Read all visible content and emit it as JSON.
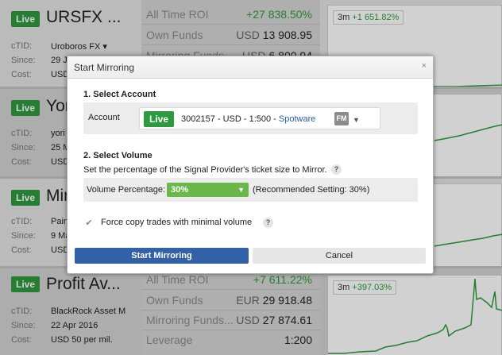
{
  "cards": [
    {
      "live": "Live",
      "title": "URSFX ...",
      "info": [
        {
          "label": "cTID:",
          "value": "Uroboros FX ▾"
        },
        {
          "label": "Since:",
          "value": "29 J"
        },
        {
          "label": "Cost:",
          "value": "USD"
        }
      ],
      "stats": [
        {
          "label": "All Time ROI",
          "currency": "",
          "value": "+27 838.50%"
        },
        {
          "label": "Own Funds",
          "currency": "USD",
          "value": "13 908.95"
        },
        {
          "label": "Mirroring Funds",
          "currency": "USD",
          "value": "6 800.94"
        }
      ],
      "chart_period": "3m",
      "chart_change": "+1 651.82%"
    },
    {
      "live": "Live",
      "title": "Yor",
      "info": [
        {
          "label": "cTID:",
          "value": "yori"
        },
        {
          "label": "Since:",
          "value": "25 M"
        },
        {
          "label": "Cost:",
          "value": "USD"
        }
      ],
      "stats": [],
      "chart_period": "",
      "chart_change": ""
    },
    {
      "live": "Live",
      "title": "Mir",
      "info": [
        {
          "label": "cTID:",
          "value": "Pain"
        },
        {
          "label": "Since:",
          "value": "9 Ma"
        },
        {
          "label": "Cost:",
          "value": "USD"
        }
      ],
      "stats": [],
      "chart_period": "",
      "chart_change": ""
    },
    {
      "live": "Live",
      "title": "Profit Av...",
      "info": [
        {
          "label": "cTID:",
          "value": "BlackRock Asset M"
        },
        {
          "label": "Since:",
          "value": "22 Apr 2016"
        },
        {
          "label": "Cost:",
          "value": "USD 50 per mil."
        }
      ],
      "stats": [
        {
          "label": "All Time ROI",
          "currency": "",
          "value": "+7 611.22%"
        },
        {
          "label": "Own Funds",
          "currency": "EUR",
          "value": "29 918.48"
        },
        {
          "label": "Mirroring Funds...",
          "currency": "USD",
          "value": "27 874.61"
        },
        {
          "label": "Leverage",
          "currency": "",
          "value": "1:200"
        }
      ],
      "chart_period": "3m",
      "chart_change": "+397.03%"
    }
  ],
  "modal": {
    "title": "Start Mirroring",
    "close": "×",
    "section1": "1. Select Account",
    "account_label": "Account",
    "account_live": "Live",
    "account_text": "3002157 - USD - 1:500 - ",
    "account_broker": "Spotware",
    "account_badge": "FM",
    "caret": "▼",
    "section2": "2. Select Volume",
    "description": "Set the percentage of the Signal Provider's ticket size to Mirror.",
    "help": "?",
    "volume_label": "Volume Percentage:",
    "volume_value": "30%",
    "volume_rec": "(Recommended Setting: 30%)",
    "check_mark": "✔",
    "force_copy": "Force copy trades with minimal volume",
    "start_button": "Start Mirroring",
    "cancel_button": "Cancel"
  },
  "colors": {
    "live_green": "#2e9a3e",
    "positive": "#2e9a3e",
    "primary_button": "#3361a8",
    "volume_select": "#6bb84a",
    "link": "#2a5db0"
  }
}
